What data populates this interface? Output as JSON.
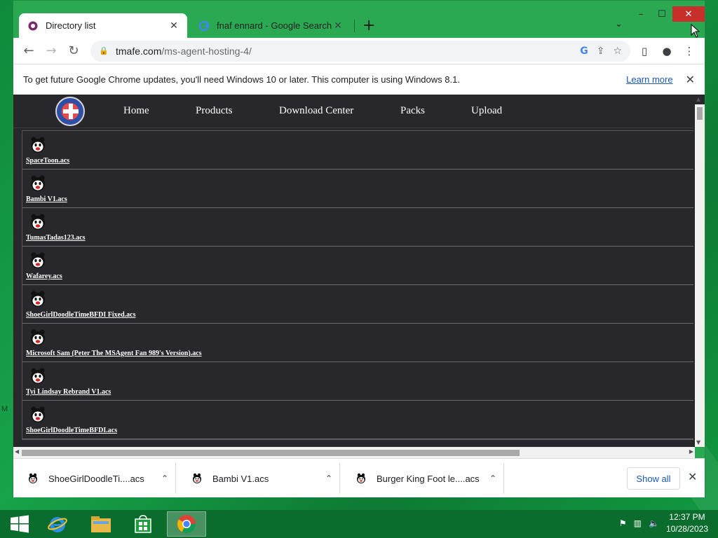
{
  "browser": {
    "tabs": [
      {
        "label": "Directory list",
        "active": true
      },
      {
        "label": "fnaf ennard - Google Search",
        "active": false
      }
    ],
    "new_tab": "+",
    "window_controls": {
      "minimize": "–",
      "maximize": "☐",
      "close": "✕"
    },
    "url_host": "tmafe.com",
    "url_path": "/ms-agent-hosting-4/",
    "infobar": {
      "message": "To get future Google Chrome updates, you'll need Windows 10 or later. This computer is using Windows 8.1.",
      "link": "Learn more"
    }
  },
  "site": {
    "nav": [
      "Home",
      "Products",
      "Download Center",
      "Packs",
      "Upload"
    ]
  },
  "files": [
    "SpaceToon.acs",
    "Bambi V1.acs",
    "TumasTadas123.acs",
    "Wafarey.acs",
    "ShoeGirlDoodleTimeBFDI Fixed.acs",
    "Microsoft Sam (Peter The MSAgent Fan 989's Version).acs",
    "Tyi Lindsay Rebrand V1.acs",
    "ShoeGirlDoodleTimeBFDI.acs"
  ],
  "downloads": {
    "items": [
      "ShoeGirlDoodleTi....acs",
      "Bambi V1.acs",
      "Burger King Foot le....acs"
    ],
    "show_all": "Show all"
  },
  "taskbar": {
    "time": "12:37 PM",
    "date": "10/28/2023"
  },
  "desktop_edge_text": "M",
  "colors": {
    "desktop": "#17a34a",
    "page_bg": "#28282c",
    "link": "#1a57b8",
    "close_btn": "#c7302a"
  }
}
